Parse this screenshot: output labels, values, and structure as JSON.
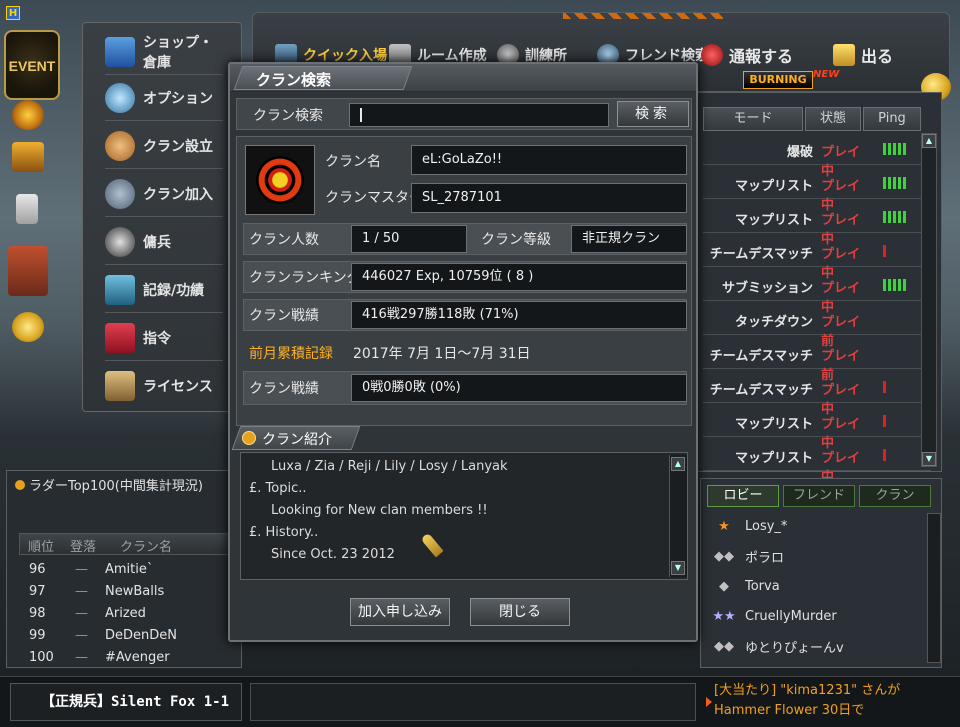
{
  "colors": {
    "accent": "#ffd040",
    "danger": "#e04040",
    "ping_good": "#3ed23e",
    "ping_bad": "#e02020",
    "ticker": "#f0a020"
  },
  "corner_badge": "H",
  "event_badge": "EVENT",
  "side_menu": {
    "items": [
      {
        "label": "ショップ・倉庫",
        "icon": "shop-icon"
      },
      {
        "label": "オプション",
        "icon": "options-icon"
      },
      {
        "label": "クラン設立",
        "icon": "clan-create-icon"
      },
      {
        "label": "クラン加入",
        "icon": "clan-join-icon"
      },
      {
        "label": "傭兵",
        "icon": "mercenary-icon"
      },
      {
        "label": "記録/功績",
        "icon": "records-icon"
      },
      {
        "label": "指令",
        "icon": "orders-icon"
      },
      {
        "label": "ライセンス",
        "icon": "license-icon"
      }
    ]
  },
  "top_nav": {
    "quick_join": "クイック入場",
    "room_create": "ルーム作成",
    "training": "訓練所",
    "friend_search": "フレンド検索",
    "report": "通報する",
    "exit": "出る"
  },
  "burning": {
    "label": "BURNING",
    "new": "NEW"
  },
  "room_list": {
    "headers": {
      "mode": "モード",
      "state": "状態",
      "ping": "Ping"
    },
    "rows": [
      {
        "mode": "爆破",
        "state": "プレイ中",
        "ping": 5,
        "ping_color": "green"
      },
      {
        "mode": "マップリスト",
        "state": "プレイ中",
        "ping": 5,
        "ping_color": "green"
      },
      {
        "mode": "マップリスト",
        "state": "プレイ中",
        "ping": 5,
        "ping_color": "green"
      },
      {
        "mode": "チームデスマッチ",
        "state": "プレイ中",
        "ping": 1,
        "ping_color": "red"
      },
      {
        "mode": "サブミッション",
        "state": "プレイ中",
        "ping": 5,
        "ping_color": "green"
      },
      {
        "mode": "タッチダウン",
        "state": "プレイ前",
        "ping": 0,
        "ping_color": "none"
      },
      {
        "mode": "チームデスマッチ",
        "state": "プレイ前",
        "ping": 0,
        "ping_color": "none"
      },
      {
        "mode": "チームデスマッチ",
        "state": "プレイ中",
        "ping": 1,
        "ping_color": "red"
      },
      {
        "mode": "マップリスト",
        "state": "プレイ中",
        "ping": 1,
        "ping_color": "red"
      },
      {
        "mode": "マップリスト",
        "state": "プレイ中",
        "ping": 1,
        "ping_color": "red"
      }
    ]
  },
  "lobby": {
    "tabs": [
      "ロビー",
      "フレンド",
      "クラン"
    ],
    "players": [
      "Losy_*",
      "ポラロ",
      "Torva",
      "CruellyMurder",
      "ゆとりぴょーんv"
    ]
  },
  "ladder": {
    "title": "ラダーTop100(中間集計現況)",
    "headers": {
      "rank": "順位",
      "change": "登落",
      "clan": "クラン名"
    },
    "rows": [
      {
        "rank": "96",
        "change": "—",
        "clan": "Amitie`"
      },
      {
        "rank": "97",
        "change": "—",
        "clan": "NewBalls"
      },
      {
        "rank": "98",
        "change": "—",
        "clan": "Arized"
      },
      {
        "rank": "99",
        "change": "—",
        "clan": "DeDenDeN"
      },
      {
        "rank": "100",
        "change": "—",
        "clan": "#Avenger"
      }
    ]
  },
  "player_tag": "【正規兵】Silent Fox 1-1",
  "ticker": {
    "line1": "[大当たり] \"kima1231\" さんが",
    "line2": "Hammer Flower 30日で"
  },
  "dialog": {
    "title": "クラン検索",
    "search_label": "クラン検索",
    "search_value": "",
    "search_button": "検索",
    "clan_name_label": "クラン名",
    "clan_name": "eL:GoLaZo!!",
    "clan_master_label": "クランマスター",
    "clan_master": "SL_2787101",
    "members_label": "クラン人数",
    "members": "1 / 50",
    "level_label": "クラン等級",
    "level": "非正規クラン",
    "ranking_label": "クランランキング",
    "ranking": "446027 Exp, 10759位 ( 8 )",
    "record_label": "クラン戦績",
    "record": "416戦297勝118敗 (71%)",
    "prev_month_label": "前月累積記録",
    "prev_month_period": "2017年 7月 1日～7月 31日",
    "prev_record_label": "クラン戦績",
    "prev_record": "0戦0勝0敗 (0%)",
    "intro_label": "クラン紹介",
    "intro_lines": [
      "Luxa / Zia / Reji / Lily / Losy / Lanyak",
      "£. Topic..",
      "Looking for New clan members !!",
      "£. History..",
      "Since Oct. 23 2012"
    ],
    "apply_button": "加入申し込み",
    "close_button": "閉じる"
  }
}
